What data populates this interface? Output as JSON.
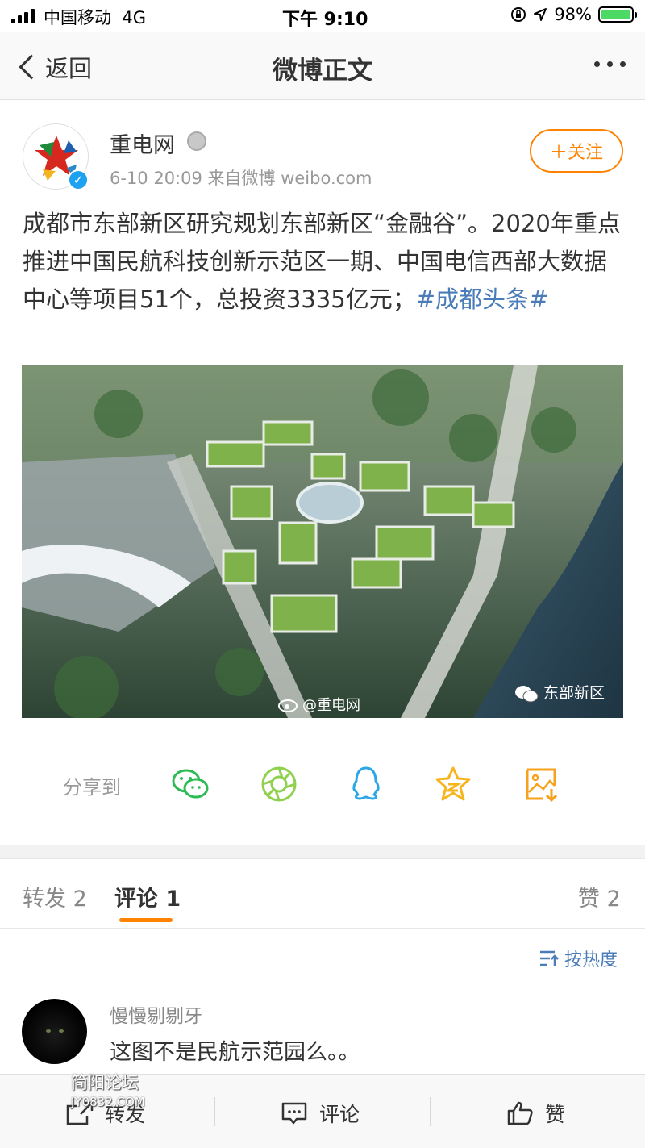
{
  "status_bar": {
    "carrier": "中国移动",
    "network": "4G",
    "time": "下午 9:10",
    "battery": "98%",
    "battery_level": 0.98
  },
  "nav": {
    "back_label": "返回",
    "title": "微博正文"
  },
  "post": {
    "author": "重电网",
    "meta": "6-10 20:09  来自微博 weibo.com",
    "follow_label": "＋关注",
    "text": "成都市东部新区研究规划东部新区“金融谷”。2020年重点推进中国民航科技创新示范区一期、中国电信西部大数据中心等项目51个，总投资3335亿元；",
    "hashtag": "#成都头条#",
    "image_watermark_left": "@重电网",
    "image_watermark_right": "东部新区"
  },
  "share": {
    "label": "分享到",
    "targets": [
      "wechat-icon",
      "moments-icon",
      "qq-icon",
      "qzone-icon",
      "save-image-icon"
    ]
  },
  "tabs": {
    "repost": "转发 2",
    "comment": "评论 1",
    "like": "赞 2"
  },
  "sort_label": "按热度",
  "comments": [
    {
      "user": "慢慢剔剔牙",
      "text": "这图不是民航示范园么。。"
    }
  ],
  "toolbar": {
    "repost": "转发",
    "comment": "评论",
    "like": "赞"
  },
  "watermark": {
    "title": "简阳论坛",
    "url": "JY0832.COM"
  },
  "colors": {
    "accent": "#ff8200",
    "link": "#4a7cb8",
    "verified": "#1da1f2"
  }
}
